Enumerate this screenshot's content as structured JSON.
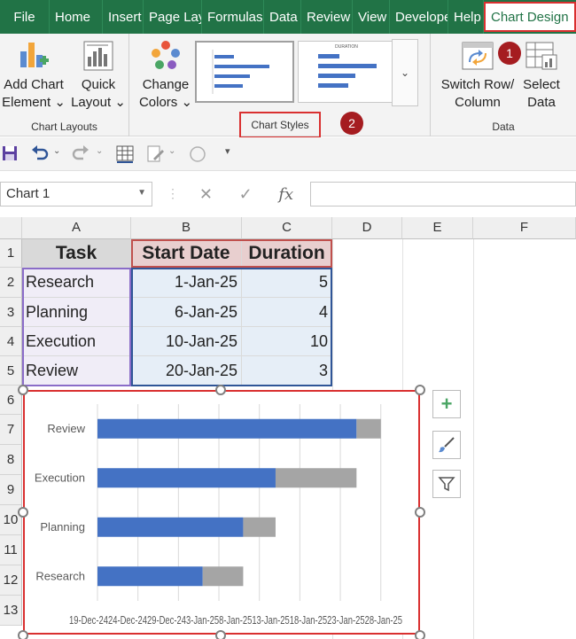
{
  "menu": {
    "tabs": [
      "File",
      "Home",
      "Insert",
      "Page Layo",
      "Formulas",
      "Data",
      "Review",
      "View",
      "Develope",
      "Help",
      "Chart Design"
    ]
  },
  "ribbon": {
    "add_chart_element": "Add Chart Element",
    "add_chart_line1": "Add Chart",
    "add_chart_line2": "Element",
    "quick_layout_line1": "Quick",
    "quick_layout_line2": "Layout",
    "group_chart_layouts": "Chart Layouts",
    "change_colors_line1": "Change",
    "change_colors_line2": "Colors",
    "group_chart_styles": "Chart Styles",
    "switch_row_line1": "Switch Row/",
    "switch_row_line2": "Column",
    "select_data_line1": "Select",
    "select_data_line2": "Data",
    "group_data": "Data",
    "badge1": "1",
    "badge2": "2",
    "thumb2_title": "DURATION"
  },
  "formula_bar": {
    "name_box": "Chart 1",
    "fx": "fx",
    "value": ""
  },
  "columns": [
    "A",
    "B",
    "C",
    "D",
    "E",
    "F"
  ],
  "rows": [
    "1",
    "2",
    "3",
    "4",
    "5",
    "6",
    "7",
    "8",
    "9",
    "10",
    "11",
    "12",
    "13"
  ],
  "table": {
    "headers": [
      "Task",
      "Start Date",
      "Duration"
    ],
    "rows": [
      [
        "Research",
        "1-Jan-25",
        "5"
      ],
      [
        "Planning",
        "6-Jan-25",
        "4"
      ],
      [
        "Execution",
        "10-Jan-25",
        "10"
      ],
      [
        "Review",
        "20-Jan-25",
        "3"
      ]
    ]
  },
  "colors": {
    "excel_green": "#217346",
    "highlight_red": "#d93030",
    "badge_red": "#a51c20",
    "series_start": "#4472c4",
    "series_duration": "#a5a5a5"
  },
  "chart_data": {
    "type": "bar",
    "orientation": "horizontal",
    "stacked": true,
    "categories": [
      "Research",
      "Planning",
      "Execution",
      "Review"
    ],
    "series": [
      {
        "values": [
          45658,
          45663,
          45667,
          45677
        ],
        "color": "#4472c4"
      },
      {
        "values": [
          5,
          4,
          10,
          3
        ],
        "color": "#a5a5a5"
      }
    ],
    "xlim": [
      "19-Dec-24",
      "25-Jan-25"
    ],
    "x_tick_labels": [
      "19-Dec-24",
      "24-Dec-24",
      "29-Dec-24",
      "3-Jan-25",
      "8-Jan-25",
      "13-Jan-25",
      "18-Jan-25",
      "23-Jan-25",
      "28-Jan-25"
    ],
    "x_tick_label_text": "19-Dec-2424-Dec-2429-Dec-243-Jan-258-Jan-2513-Jan-2518-Jan-2523-Jan-2528-Jan-25",
    "grid": true,
    "legend": "none",
    "title": ""
  }
}
